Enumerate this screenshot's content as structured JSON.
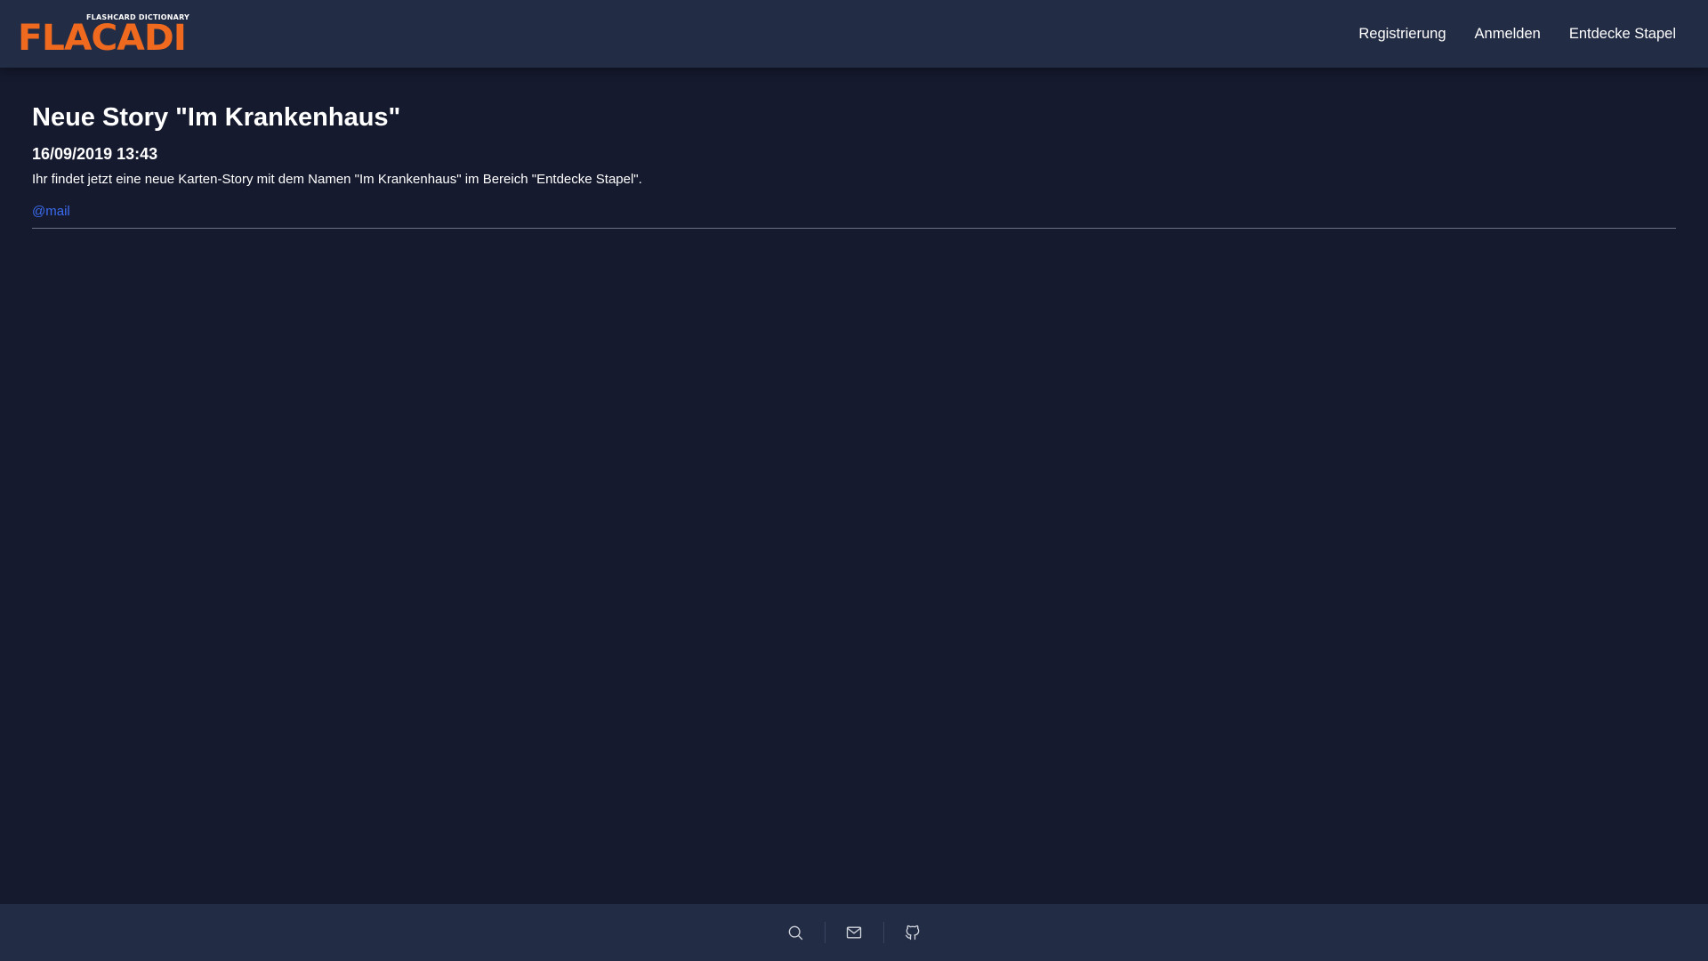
{
  "brand": {
    "name": "FLACADI",
    "tagline": "FLASHCARD DICTIONARY",
    "color": "#ef6a1f"
  },
  "nav": {
    "links": [
      {
        "label": "Registrierung"
      },
      {
        "label": "Anmelden"
      },
      {
        "label": "Entdecke Stapel"
      }
    ]
  },
  "post": {
    "title": "Neue Story \"Im Krankenhaus\"",
    "date": "16/09/2019 13:43",
    "body": "Ihr findet jetzt eine neue Karten-Story mit dem Namen \"Im Krankenhaus\" im Bereich \"Entdecke Stapel\".",
    "author": "@mail"
  },
  "footer": {
    "icons": [
      "search-icon",
      "mail-icon",
      "github-icon"
    ]
  },
  "colors": {
    "background": "#151a2e",
    "bar": "#232c45",
    "link": "#3b6cf0"
  }
}
